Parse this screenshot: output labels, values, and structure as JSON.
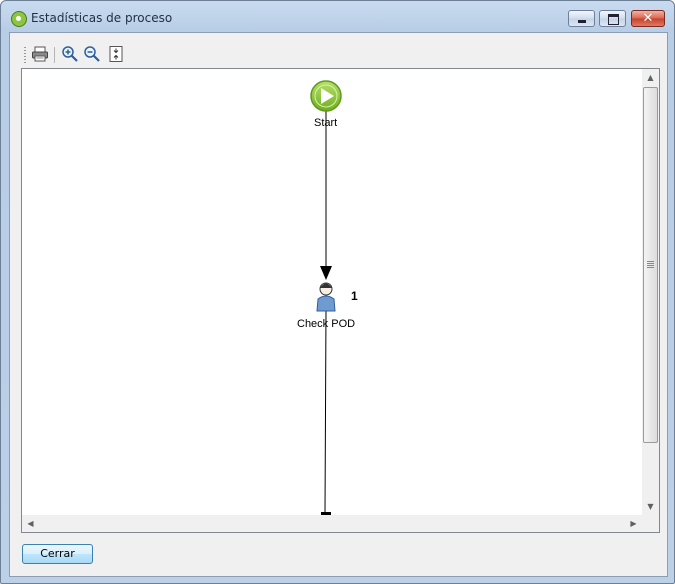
{
  "window": {
    "title": "Estadísticas de proceso"
  },
  "toolbar": {
    "buttons": [
      {
        "icon": "printer-icon"
      },
      {
        "icon": "zoom-in-icon"
      },
      {
        "icon": "zoom-out-icon"
      },
      {
        "icon": "fit-to-page-icon"
      }
    ]
  },
  "diagram": {
    "nodes": [
      {
        "id": "start",
        "label": "Start",
        "icon": "play-icon",
        "color": "#8cc63f"
      },
      {
        "id": "check-pod",
        "label": "Check POD",
        "icon": "user-task-icon",
        "count": "1",
        "color": "#6f9bd1"
      }
    ]
  },
  "footer": {
    "close_label": "Cerrar"
  },
  "colors": {
    "window_frame": "#b9cde5",
    "start_node": "#8cc63f",
    "task_node": "#6f9bd1"
  }
}
